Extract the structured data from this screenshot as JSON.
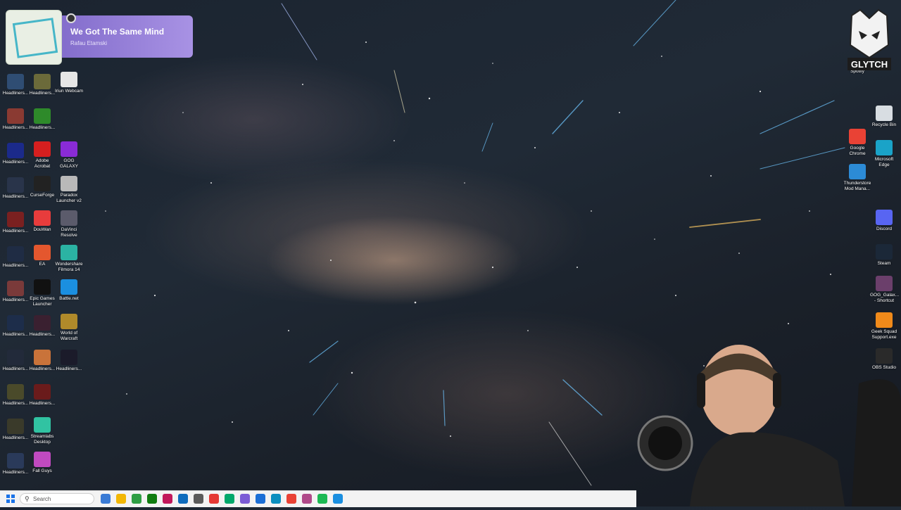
{
  "now_playing": {
    "title": "We Got The Same Mind",
    "artist": "Rafau Etamski"
  },
  "left_icons": [
    {
      "label": "Headliners...",
      "color": "#2f4d73"
    },
    {
      "label": "Headliners...",
      "color": "#6b6a3a"
    },
    {
      "label": "Iriun Webcam",
      "color": "#e6e6e6"
    },
    {
      "label": "Headliners...",
      "color": "#8a3a32"
    },
    {
      "label": "Headliners...",
      "color": "#2e8a2a"
    },
    {
      "label": "Headliners...",
      "color": "#1b2a8a"
    },
    {
      "label": "Adobe Acrobat",
      "color": "#d61f1f"
    },
    {
      "label": "GOG GALAXY",
      "color": "#8a2bd6"
    },
    {
      "label": "Headliners...",
      "color": "#29344a"
    },
    {
      "label": "CurseForge",
      "color": "#222222"
    },
    {
      "label": "Paradox Launcher v2",
      "color": "#b9b9b9"
    },
    {
      "label": "Headliners...",
      "color": "#7a2020"
    },
    {
      "label": "DouWan",
      "color": "#e83c3c"
    },
    {
      "label": "DaVinci Resolve",
      "color": "#5b5b6b"
    },
    {
      "label": "Headliners...",
      "color": "#1f2c44"
    },
    {
      "label": "EA",
      "color": "#e4572e"
    },
    {
      "label": "Wondershare Filmora 14",
      "color": "#2bb3a3"
    },
    {
      "label": "Headliners...",
      "color": "#7a3a3a"
    },
    {
      "label": "Epic Games Launcher",
      "color": "#111111"
    },
    {
      "label": "Battle.net",
      "color": "#1b8fe0"
    },
    {
      "label": "Headliners...",
      "color": "#1d2d4a"
    },
    {
      "label": "Headliners...",
      "color": "#3a2030"
    },
    {
      "label": "World of Warcraft",
      "color": "#b08a2a"
    },
    {
      "label": "Headliners...",
      "color": "#222a3a"
    },
    {
      "label": "Headliners...",
      "color": "#c9733a"
    },
    {
      "label": "Headliners...",
      "color": "#1b1b2a"
    },
    {
      "label": "Headliners...",
      "color": "#4a4a2a"
    },
    {
      "label": "Headliners...",
      "color": "#6a1b1b"
    },
    {
      "label": "Headliners...",
      "color": "#3a3a2a"
    },
    {
      "label": "Streamlabs Desktop",
      "color": "#31c3a2"
    },
    {
      "label": "Headliners...",
      "color": "#2a3a5a"
    },
    {
      "label": "Fall Guys",
      "color": "#c04ac0"
    }
  ],
  "right_icons": [
    {
      "label": "Spotify",
      "color": "#000000"
    },
    {
      "label": "Recycle Bin",
      "color": "#d8dde2"
    },
    {
      "label": "Google Chrome",
      "color": "#e94235"
    },
    {
      "label": "Microsoft Edge",
      "color": "#1aa3c8"
    },
    {
      "label": "Thunderstore Mod Mana...",
      "color": "#2c8bd6"
    },
    {
      "label": "Discord",
      "color": "#5865f2"
    },
    {
      "label": "Steam",
      "color": "#1b2838"
    },
    {
      "label": "GOG_Galax... - Shortcut",
      "color": "#6b3f6b"
    },
    {
      "label": "Geek Squad Support.exe",
      "color": "#f08a1a"
    },
    {
      "label": "OBS Studio",
      "color": "#2a2a2a"
    }
  ],
  "logo_text": "GLYTCH",
  "taskbar": {
    "search_placeholder": "Search",
    "apps": [
      "#3a7bd5",
      "#f2b705",
      "#2f9e44",
      "#107c10",
      "#c2185b",
      "#0f6cbd",
      "#5b5b5b",
      "#e53935",
      "#00a86b",
      "#7b5cd6",
      "#1b6fd6",
      "#0b8fbf",
      "#e94235",
      "#b04a8a",
      "#1db954",
      "#1b8fe0"
    ]
  }
}
